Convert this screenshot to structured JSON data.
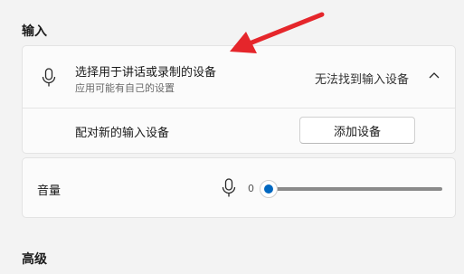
{
  "input_section": {
    "title": "输入",
    "device_select": {
      "label": "选择用于讲话或录制的设备",
      "sublabel": "应用可能有自己的设置",
      "status": "无法找到输入设备",
      "expanded": true
    },
    "pair_new": {
      "label": "配对新的输入设备",
      "button_label": "添加设备"
    },
    "volume": {
      "label": "音量",
      "value": "0",
      "level": 0
    }
  },
  "advanced_section": {
    "title": "高级"
  },
  "colors": {
    "accent": "#0067c0",
    "annotation_arrow": "#e5262b"
  },
  "icons": [
    "microphone-icon",
    "chevron-up-icon"
  ]
}
